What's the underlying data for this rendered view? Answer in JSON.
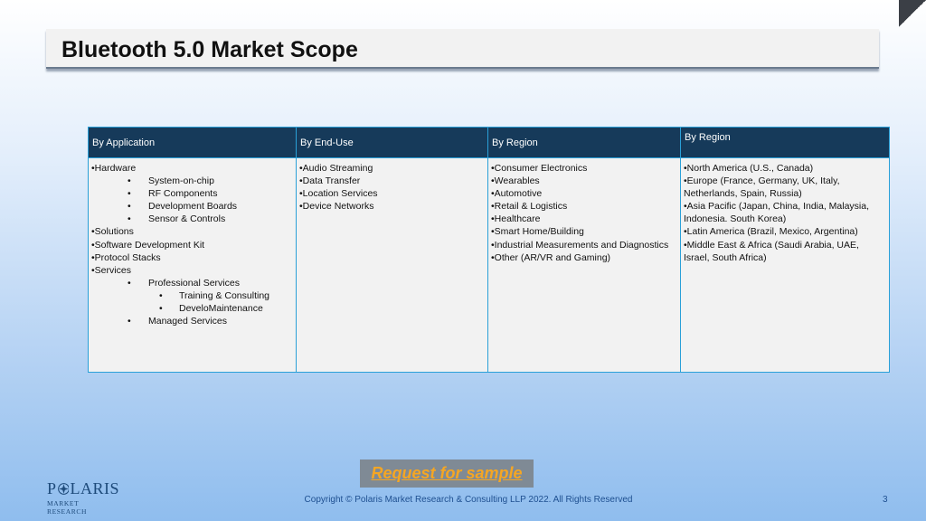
{
  "slide": {
    "title": "Bluetooth 5.0 Market Scope",
    "cta_label": "Request for sample",
    "copyright": "Copyright © Polaris Market Research & Consulting LLP 2022. All Rights Reserved",
    "page_number": "3",
    "logo": {
      "name_part1": "P",
      "name_part2": "LARIS",
      "subtitle": "MARKET RESEARCH"
    },
    "colors": {
      "header_bg": "#163a5a",
      "border": "#2aa0d8",
      "cta_text": "#f5a623",
      "cta_bg": "#7f8a95"
    }
  },
  "table": {
    "headers": [
      "By Application",
      "By End-Use",
      "By Region",
      "By Region"
    ],
    "application": [
      {
        "text": "•Hardware",
        "level": 0
      },
      {
        "text": "System-on-chip",
        "level": 1
      },
      {
        "text": "RF Components",
        "level": 1
      },
      {
        "text": "Development Boards",
        "level": 1
      },
      {
        "text": "Sensor & Controls",
        "level": 1
      },
      {
        "text": "•Solutions",
        "level": 0
      },
      {
        "text": "•Software Development Kit",
        "level": 0
      },
      {
        "text": "•Protocol Stacks",
        "level": 0
      },
      {
        "text": "•Services",
        "level": 0
      },
      {
        "text": "Professional Services",
        "level": 1
      },
      {
        "text": "Training & Consulting",
        "level": 2
      },
      {
        "text": "DeveloMaintenance",
        "level": 2
      },
      {
        "text": "Managed Services",
        "level": 1
      }
    ],
    "end_use": [
      "•Audio Streaming",
      "•Data Transfer",
      "•Location Services",
      "•Device Networks"
    ],
    "region_verticals": [
      "•Consumer Electronics",
      "•Wearables",
      "•Automotive",
      "•Retail & Logistics",
      "•Healthcare",
      "•Smart Home/Building",
      "•Industrial Measurements and Diagnostics",
      "•Other (AR/VR and Gaming)"
    ],
    "region_geo": [
      "•North America (U.S., Canada)",
      "•Europe (France, Germany, UK, Italy, Netherlands, Spain, Russia)",
      "•Asia Pacific (Japan, China, India, Malaysia, Indonesia. South Korea)",
      "•Latin America (Brazil, Mexico, Argentina)",
      "•Middle East & Africa (Saudi Arabia, UAE, Israel, South Africa)"
    ]
  }
}
